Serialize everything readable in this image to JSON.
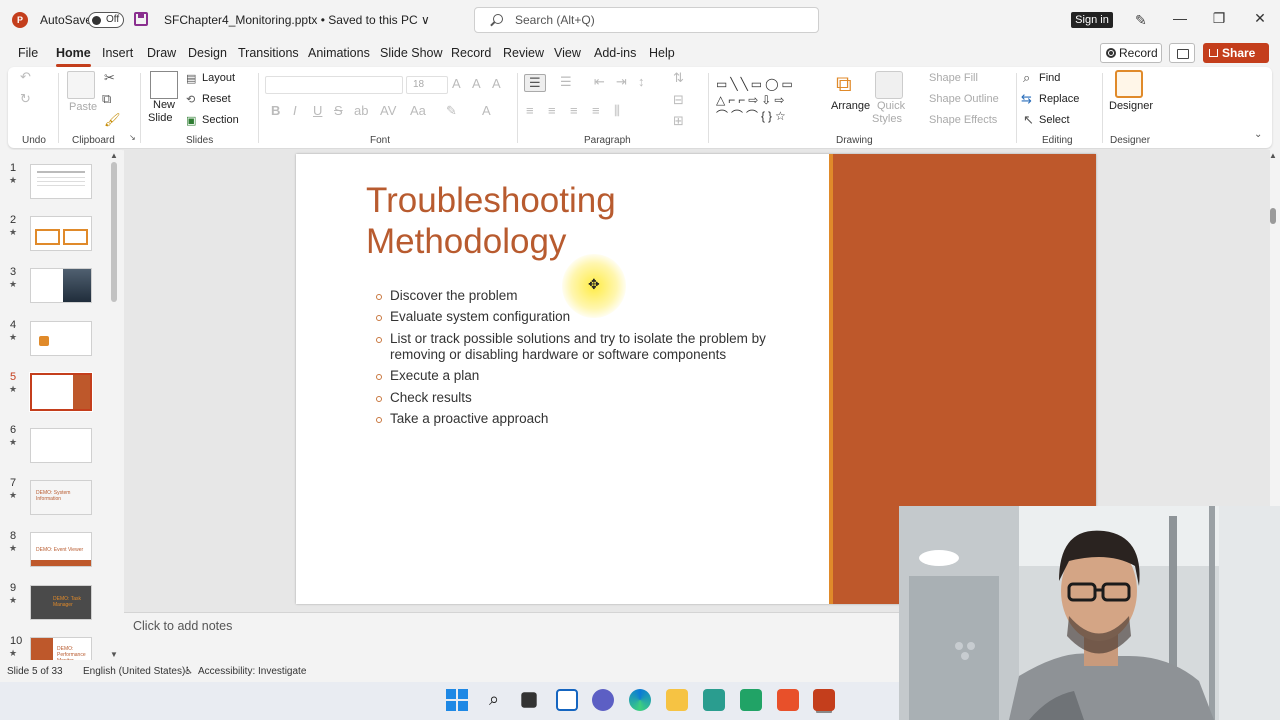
{
  "titlebar": {
    "app_icon": "P",
    "autosave_label": "AutoSave",
    "autosave_state": "Off",
    "document_title": "SFChapter4_Monitoring.pptx • Saved to this PC ∨",
    "search_placeholder": "Search (Alt+Q)",
    "signin_label": "Sign in",
    "minimize": "—",
    "restore": "❐",
    "close": "✕"
  },
  "menu": {
    "tabs": [
      "File",
      "Home",
      "Insert",
      "Draw",
      "Design",
      "Transitions",
      "Animations",
      "Slide Show",
      "Record",
      "Review",
      "View",
      "Add-ins",
      "Help"
    ],
    "active_tab": "Home",
    "record_label": "Record",
    "share_label": "Share"
  },
  "ribbon": {
    "groups": {
      "undo": "Undo",
      "clipboard": "Clipboard",
      "slides": "Slides",
      "font": "Font",
      "paragraph": "Paragraph",
      "drawing": "Drawing",
      "editing": "Editing",
      "designer": "Designer"
    },
    "paste_label": "Paste",
    "new_slide_label": "New",
    "new_slide_label2": "Slide",
    "layout_label": "Layout",
    "reset_label": "Reset",
    "section_label": "Section",
    "font_size_value": "18",
    "arrange_label": "Arrange",
    "quick_styles_label": "Quick",
    "quick_styles_label2": "Styles",
    "shape_fill_label": "Shape Fill",
    "shape_outline_label": "Shape Outline",
    "shape_effects_label": "Shape Effects",
    "find_label": "Find",
    "replace_label": "Replace",
    "select_label": "Select",
    "designer_label": "Designer",
    "bold": "B",
    "italic": "I",
    "underline": "U",
    "strike": "S"
  },
  "thumbnails": {
    "numbers": [
      "1",
      "2",
      "3",
      "4",
      "5",
      "6",
      "7",
      "8",
      "9",
      "10"
    ],
    "active": "5",
    "slide7_text": "DEMO: System Information",
    "slide8_text": "DEMO: Event Viewer",
    "slide9_text": "DEMO: Task Manager",
    "slide10_text": "DEMO: Performance Monitor"
  },
  "slide": {
    "title_line1": "Troubleshooting",
    "title_line2": "Methodology",
    "bullets": [
      "Discover the problem",
      "Evaluate system configuration",
      "List or track possible solutions and try to isolate the problem by removing or disabling hardware or software components",
      "Execute a plan",
      "Check results",
      "Take a proactive approach"
    ],
    "accent_color": "#be582b",
    "bar_color": "#e08a2a",
    "title_color": "#b85b2f"
  },
  "notes": {
    "placeholder": "Click to add notes"
  },
  "status": {
    "slide_count": "Slide 5 of 33",
    "language": "English (United States)",
    "accessibility": "Accessibility: Investigate"
  },
  "colors": {
    "brand": "#c43e1c"
  }
}
